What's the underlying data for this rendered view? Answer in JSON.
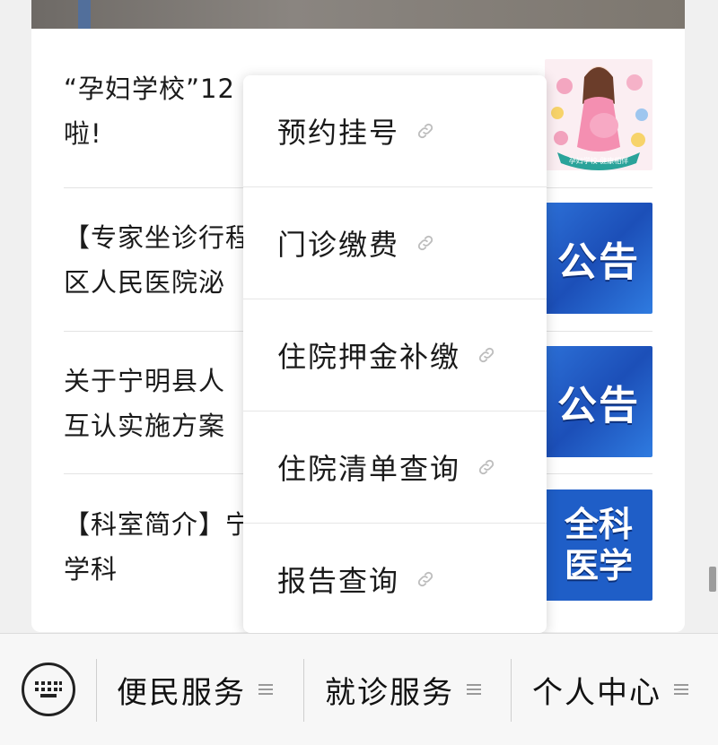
{
  "articles": [
    {
      "title": "“孕妇学校”12\n啦!",
      "thumb_label": "孕妇学校·健康相伴"
    },
    {
      "title": "【专家坐诊行程\n区人民医院泌",
      "thumb_label": "公告"
    },
    {
      "title": "关于宁明县人\n互认实施方案",
      "thumb_label": "公告"
    },
    {
      "title": "【科室简介】宁\n学科",
      "thumb_label": "全科\n医学"
    }
  ],
  "popup_menu": {
    "items": [
      "预约挂号",
      "门诊缴费",
      "住院押金补缴",
      "住院清单查询",
      "报告查询"
    ],
    "link_icon": "link-icon"
  },
  "bottom_bar": {
    "keyboard_icon": "keyboard-icon",
    "menus": [
      "便民服务",
      "就诊服务",
      "个人中心"
    ],
    "menu_icon": "hamburger-icon"
  },
  "colors": {
    "notice_blue": "#1f5ec7",
    "background": "#f0f0f0",
    "popup_bg": "#ffffff"
  }
}
